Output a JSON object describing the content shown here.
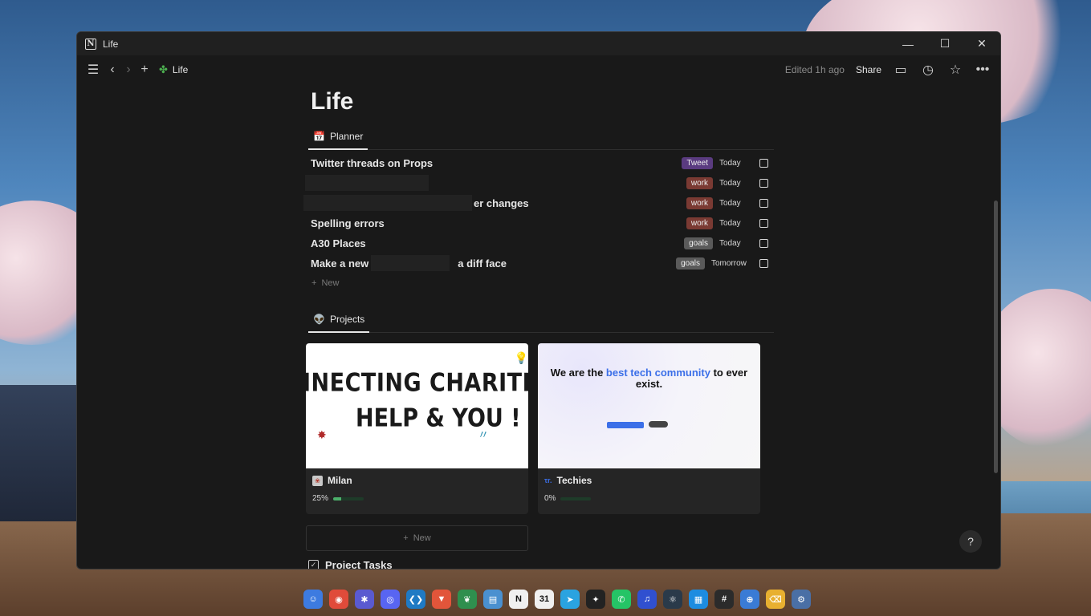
{
  "window": {
    "title": "Life",
    "app_icon": "N",
    "controls": {
      "minimize": "—",
      "maximize": "☐",
      "close": "✕"
    }
  },
  "toolbar": {
    "breadcrumb": "Life",
    "edited": "Edited 1h ago",
    "share": "Share"
  },
  "page": {
    "title": "Life",
    "planner_tab": "Planner",
    "projects_tab": "Projects",
    "new_label": "New",
    "new_card_label": "New",
    "project_tasks": "Project Tasks",
    "help": "?"
  },
  "planner": [
    {
      "name": "Twitter threads on Props",
      "tag": "Tweet",
      "tag_color": "#5a3b80",
      "date": "Today"
    },
    {
      "name": "",
      "tag": "work",
      "tag_color": "#7a3a33",
      "date": "Today"
    },
    {
      "name": "er changes",
      "tag": "work",
      "tag_color": "#7a3a33",
      "date": "Today"
    },
    {
      "name": "Spelling errors",
      "tag": "work",
      "tag_color": "#7a3a33",
      "date": "Today"
    },
    {
      "name": "A30 Places",
      "tag": "goals",
      "tag_color": "#5a5a5a",
      "date": "Today"
    },
    {
      "name": "Make a new C",
      "name_suffix": "a diff face",
      "tag": "goals",
      "tag_color": "#5a5a5a",
      "date": "Tomorrow"
    }
  ],
  "projects": [
    {
      "name": "Milan",
      "progress_label": "25%",
      "progress": 0.25,
      "cover_line1": "INECTING CHARITIES, NG",
      "cover_line2": "HELP & YOU !"
    },
    {
      "name": "Techies",
      "logo": "τr.",
      "progress_label": "0%",
      "progress": 0,
      "cover_head_a": "We are the ",
      "cover_head_blue": "best tech community",
      "cover_head_b": " to ever exist."
    }
  ],
  "dock": [
    {
      "icon": "finder-icon",
      "color": "#3d7be0",
      "glyph": "☺"
    },
    {
      "icon": "chrome-icon",
      "color": "#e04b3a",
      "glyph": "◉"
    },
    {
      "icon": "settings-icon",
      "color": "#5a5ad0",
      "glyph": "✱"
    },
    {
      "icon": "discord-icon",
      "color": "#5865f2",
      "glyph": "◎"
    },
    {
      "icon": "vscode-icon",
      "color": "#1f7ac4",
      "glyph": "❮❯"
    },
    {
      "icon": "brave-icon",
      "color": "#e2553a",
      "glyph": "▼"
    },
    {
      "icon": "mongodb-icon",
      "color": "#2f8f4e",
      "glyph": "❦"
    },
    {
      "icon": "files-icon",
      "color": "#4a90d0",
      "glyph": "▤"
    },
    {
      "icon": "notion-icon",
      "color": "#f0f0f0",
      "glyph": "N"
    },
    {
      "icon": "calendar-icon",
      "color": "#f0f0f0",
      "glyph": "31"
    },
    {
      "icon": "telegram-icon",
      "color": "#2aa3e0",
      "glyph": "➤"
    },
    {
      "icon": "figma-icon",
      "color": "#222222",
      "glyph": "✦"
    },
    {
      "icon": "whatsapp-icon",
      "color": "#25c466",
      "glyph": "✆"
    },
    {
      "icon": "audio-icon",
      "color": "#3050d0",
      "glyph": "♫"
    },
    {
      "icon": "electron-icon",
      "color": "#2a3a4a",
      "glyph": "⚛"
    },
    {
      "icon": "docker-icon",
      "color": "#1d8ce0",
      "glyph": "▦"
    },
    {
      "icon": "slack-icon",
      "color": "#2b2b2b",
      "glyph": "#"
    },
    {
      "icon": "safari-icon",
      "color": "#3a7bd5",
      "glyph": "⊕"
    },
    {
      "icon": "trash-icon",
      "color": "#e8b030",
      "glyph": "⌫"
    },
    {
      "icon": "control-center-icon",
      "color": "#4a6fa5",
      "glyph": "⚙"
    }
  ]
}
